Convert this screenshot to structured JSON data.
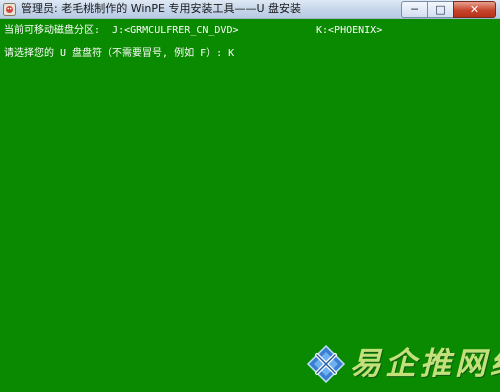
{
  "window": {
    "title": "管理员: 老毛桃制作的 WinPE 专用安装工具——U 盘安装",
    "icons": {
      "app": "app-icon",
      "minimize": "minimize-icon",
      "maximize": "maximize-icon",
      "close": "close-icon"
    },
    "controls": {
      "minimize": "─",
      "maximize": "□",
      "close": "✕"
    }
  },
  "console": {
    "line1_prefix": "当前可移动磁盘分区:  J:<GRMCULFRER_CN_DVD>",
    "line1_drive_k": "K:<PHOENIX>",
    "line2": "请选择您的 U 盘盘符（不需要冒号, 例如 F）: K"
  },
  "watermark": {
    "text": "易企推网络"
  },
  "colors": {
    "console_background": "#0a8a00",
    "console_text": "#ffffff",
    "titlebar": "#c7d6ea",
    "close_button": "#c7452c",
    "watermark_text": "#c3e07a"
  }
}
